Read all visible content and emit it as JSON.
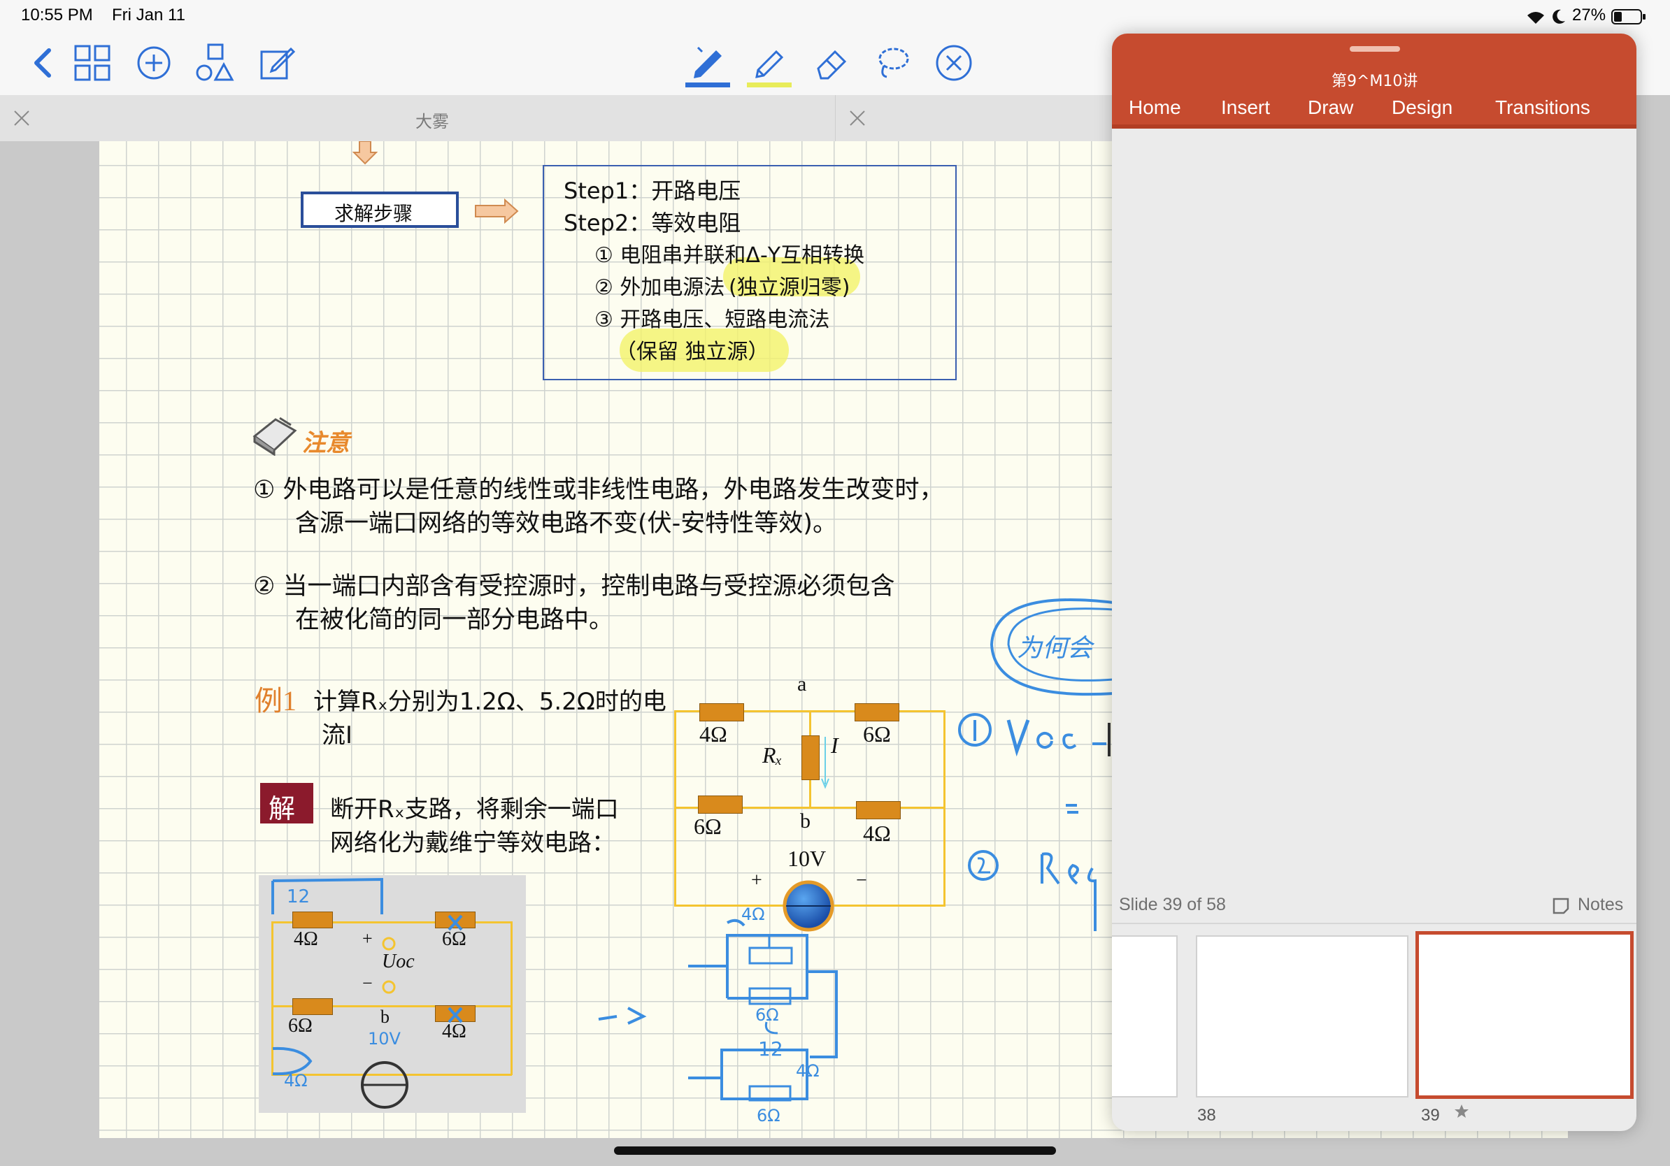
{
  "status_bar": {
    "time": "10:55 PM",
    "date": "Fri Jan 11",
    "battery": "27%"
  },
  "toolbar": {
    "left_icons": [
      "back-chevron-icon",
      "grid-view-icon",
      "add-circle-icon",
      "shapes-icon",
      "edit-note-icon"
    ],
    "center_tools": [
      "pen-icon",
      "highlighter-icon",
      "eraser-icon",
      "lasso-icon",
      "close-circle-icon"
    ],
    "accent_color": "#2f6fd6"
  },
  "tabs": [
    {
      "title": "大雾"
    }
  ],
  "notes": {
    "steps_label": "求解步骤",
    "steps_box": {
      "step1": "Step1：开路电压",
      "step2": "Step2：等效电阻",
      "item1": "① 电阻串并联和Δ-Y互相转换",
      "item2_plain": "② 外加电源法",
      "item2_highlight": "(独立源归零)",
      "item3": "③ 开路电压、短路电流法",
      "item3_note": "（保留  独立源）"
    },
    "notice_title": "注意",
    "notice_1_line1": "①  外电路可以是任意的线性或非线性电路，外电路发生改变时，",
    "notice_1_line2": "含源一端口网络的等效电路不变(伏-安特性等效)。",
    "notice_2_line1": "②  当一端口内部含有受控源时，控制电路与受控源必须包含",
    "notice_2_line2": "在被化简的同一部分电路中。",
    "example_label": "例1",
    "example_text_line1": "计算Rₓ分别为1.2Ω、5.2Ω时的电",
    "example_text_line2": "流I",
    "solution_label": "解",
    "solution_text_line1": "断开Rₓ支路，将剩余一端口",
    "solution_text_line2": "网络化为戴维宁等效电路："
  },
  "circuit_main": {
    "node_a": "a",
    "node_b": "b",
    "r_top_left": "4Ω",
    "r_top_right": "6Ω",
    "r_bottom_left": "6Ω",
    "r_bottom_right": "4Ω",
    "rx_label": "Rₓ",
    "current_label": "I",
    "source_label": "10V",
    "plus": "+",
    "minus": "−"
  },
  "circuit_small": {
    "r_top_left": "4Ω",
    "r_top_right": "6Ω",
    "r_bottom_left": "6Ω",
    "r_bottom_right": "4Ω",
    "uoc_label": "Uoc",
    "node_b": "b",
    "plus": "+",
    "minus": "−"
  },
  "handwriting": {
    "note_1": "① Voc : -",
    "note_2": "=",
    "note_3": "②. Req :",
    "bubble": "为何会",
    "scribble_1": "12",
    "scribble_2": "4Ω",
    "scribble_3": "6Ω",
    "scribble_4": "10V",
    "ink_color": "#3b8de0"
  },
  "powerpoint": {
    "file_title": "第9^M10讲",
    "tabs": [
      "Home",
      "Insert",
      "Draw",
      "Design",
      "Transitions"
    ],
    "slide_counter": "Slide 39 of 58",
    "notes_label": "Notes",
    "thumbnails": [
      {
        "number": ""
      },
      {
        "number": "38"
      },
      {
        "number": "39",
        "selected": true
      }
    ],
    "header_color": "#c64b2f"
  }
}
